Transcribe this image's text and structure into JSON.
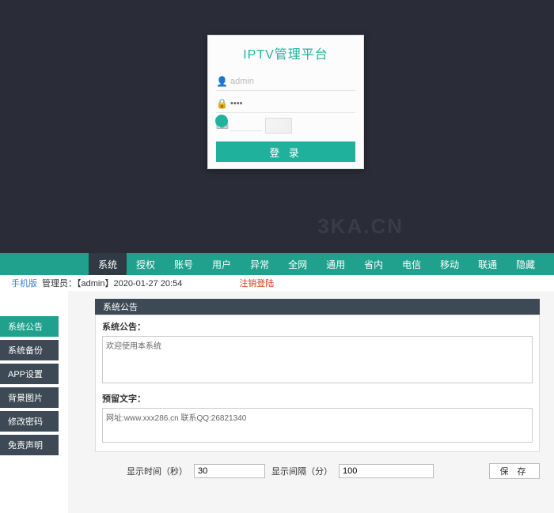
{
  "login": {
    "title": "IPTV管理平台",
    "user_placeholder": "admin",
    "pwd_value": "••••",
    "login_label": "登 录"
  },
  "watermark": "3KA.CN",
  "nav": {
    "tabs": [
      "系统",
      "授权",
      "账号",
      "用户",
      "异常",
      "全网",
      "通用",
      "省内",
      "电信",
      "移动",
      "联通",
      "隐藏"
    ],
    "active_index": 0
  },
  "infoBar": {
    "mobile": "手机版",
    "admin": "管理员：【admin】2020-01-27 20:54",
    "logout": "注销登陆"
  },
  "sidebar": {
    "items": [
      "系统公告",
      "系统备份",
      "APP设置",
      "背景图片",
      "修改密码",
      "免责声明"
    ],
    "active_index": 0
  },
  "panel": {
    "title": "系统公告",
    "notice_label": "系统公告：",
    "notice_value": "欢迎使用本系统",
    "reserve_label": "预留文字：",
    "reserve_value": "网址:www.xxx286.cn 联系QQ:26821340"
  },
  "bottom": {
    "time_label": "显示时间（秒）",
    "time_value": "30",
    "gap_label": "显示间隔（分）",
    "gap_value": "100",
    "save_label": "保 存"
  }
}
